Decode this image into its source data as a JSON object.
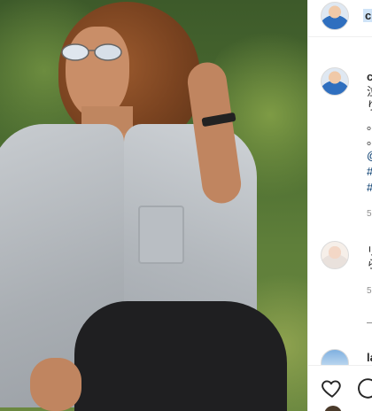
{
  "post": {
    "header_username": "c",
    "caption": {
      "username": "c",
      "lines": [
        "泣",
        "り",
        "。",
        "。",
        "@",
        "#",
        "#"
      ],
      "time": "5"
    },
    "comment": {
      "text_lines": [
        "リ",
        "ら"
      ],
      "time": "5"
    },
    "next_comment": {
      "username": "la"
    }
  },
  "actions": {
    "like": "heart-icon",
    "comment": "comment-icon"
  },
  "colors": {
    "link": "#00376b",
    "meta": "#8e8e8e",
    "highlight": "#cfe3f7"
  }
}
